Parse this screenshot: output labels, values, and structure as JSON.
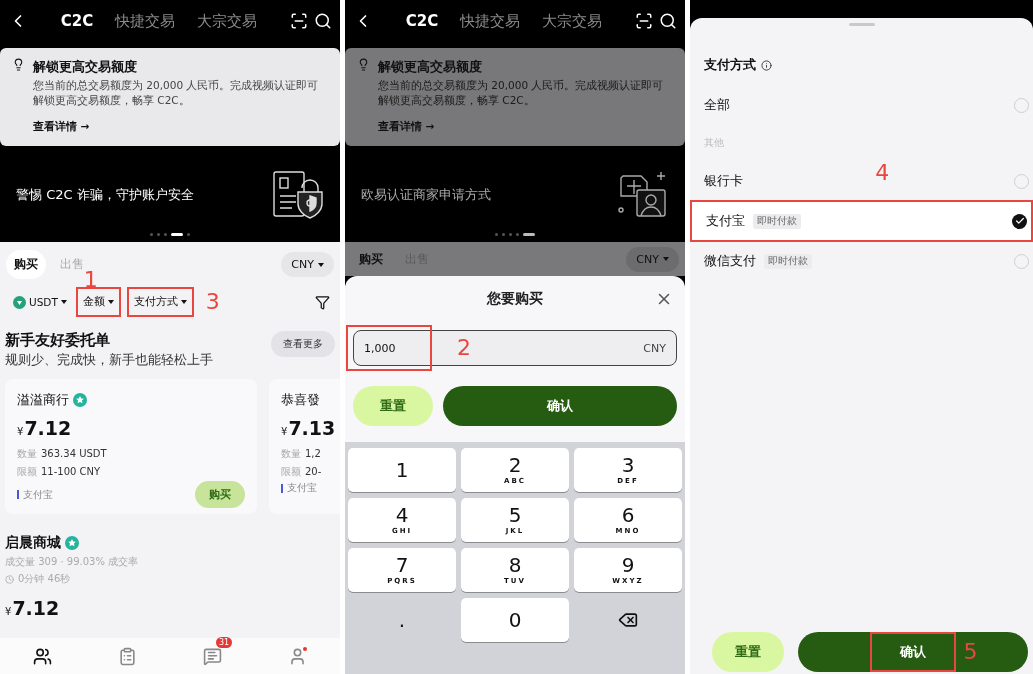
{
  "market_screen": {
    "header": {
      "tabs": [
        {
          "label": "C2C",
          "selected": true
        },
        {
          "label": "快捷交易",
          "selected": false
        },
        {
          "label": "大宗交易",
          "selected": false
        }
      ]
    },
    "notice": {
      "title": "解锁更高交易额度",
      "body": "您当前的总交易额度为 20,000 人民币。完成视频认证即可解锁更高交易额度，畅享 C2C。",
      "link": "查看详情 →"
    },
    "promo": {
      "kind": "security",
      "text": "警惕 C2C 诈骗，守护账户安全",
      "dots": [
        {
          "selected": false
        },
        {
          "selected": false
        },
        {
          "selected": false
        },
        {
          "selected": true
        },
        {
          "selected": false
        }
      ]
    },
    "side_tabs": [
      {
        "label": "购买",
        "selected": true
      },
      {
        "label": "出售",
        "selected": false
      }
    ],
    "currency": "CNY",
    "filters": [
      {
        "kind": "coin",
        "label": "USDT"
      },
      {
        "kind": "plain",
        "label": "金额",
        "callout": "1"
      },
      {
        "kind": "plain",
        "label": "支付方式",
        "callout": "3"
      }
    ],
    "section": {
      "title": "新手友好委托单",
      "subtitle": "规则少、完成快，新手也能轻松上手",
      "more": "查看更多"
    },
    "offers": [
      {
        "merchant": "溢溢商行",
        "verified": true,
        "symbol": "¥",
        "price": "7.12",
        "quantity_label": "数量",
        "quantity": "363.34 USDT",
        "limit_label": "限额",
        "limit": "11-100 CNY",
        "payment": "支付宝",
        "action": "购买"
      },
      {
        "merchant": "恭喜發",
        "verified": false,
        "symbol": "¥",
        "price": "7.13",
        "quantity_label": "数量",
        "quantity": "1,2",
        "limit_label": "限额",
        "limit": "20-",
        "payment": "支付宝"
      }
    ],
    "listing": {
      "merchant": "启晨商城",
      "verified": true,
      "stats": "成交量 309 · 99.03% 成交率",
      "time": "0分钟 46秒",
      "symbol": "¥",
      "price": "7.12"
    },
    "nav": [
      {
        "kind": "c2c",
        "selected": true
      },
      {
        "kind": "orders",
        "selected": false
      },
      {
        "kind": "messages",
        "selected": false,
        "badge": "31"
      },
      {
        "kind": "profile",
        "selected": false,
        "dot": true
      }
    ]
  },
  "amount_screen": {
    "header": {
      "tabs": [
        {
          "label": "C2C",
          "selected": true
        },
        {
          "label": "快捷交易",
          "selected": false
        },
        {
          "label": "大宗交易",
          "selected": false
        }
      ]
    },
    "notice": {
      "title": "解锁更高交易额度",
      "body": "您当前的总交易额度为 20,000 人民币。完成视频认证即可解锁更高交易额度，畅享 C2C。",
      "link": "查看详情 →"
    },
    "promo": {
      "kind": "merchant",
      "text": "欧易认证商家申请方式",
      "dots": [
        {
          "selected": false
        },
        {
          "selected": false
        },
        {
          "selected": false
        },
        {
          "selected": false
        },
        {
          "selected": true
        }
      ]
    },
    "side_tabs": [
      {
        "label": "购买",
        "selected": true
      },
      {
        "label": "出售",
        "selected": false
      }
    ],
    "currency": "CNY",
    "sheet": {
      "title": "您要购买",
      "amount": {
        "value": "1,000",
        "unit": "CNY",
        "callout": "2"
      },
      "reset": "重置",
      "confirm": "确认",
      "keys": [
        {
          "kind": "digit",
          "label": "1"
        },
        {
          "kind": "digit",
          "label": "2",
          "letters": "ABC"
        },
        {
          "kind": "digit",
          "label": "3",
          "letters": "DEF"
        },
        {
          "kind": "digit",
          "label": "4",
          "letters": "GHI"
        },
        {
          "kind": "digit",
          "label": "5",
          "letters": "JKL"
        },
        {
          "kind": "digit",
          "label": "6",
          "letters": "MNO"
        },
        {
          "kind": "digit",
          "label": "7",
          "letters": "PQRS"
        },
        {
          "kind": "digit",
          "label": "8",
          "letters": "TUV"
        },
        {
          "kind": "digit",
          "label": "9",
          "letters": "WXYZ"
        },
        {
          "kind": "symbol",
          "label": "."
        },
        {
          "kind": "digit",
          "label": "0"
        },
        {
          "kind": "backspace"
        }
      ]
    }
  },
  "payment_screen": {
    "sheet": {
      "title": "支付方式",
      "options": [
        {
          "kind": "option",
          "label": "全部",
          "selected": false
        },
        {
          "kind": "group",
          "label": "其他"
        },
        {
          "kind": "option",
          "label": "银行卡",
          "selected": false
        },
        {
          "kind": "option",
          "label": "支付宝",
          "tag": "即时付款",
          "selected": true,
          "callout": "4"
        },
        {
          "kind": "option",
          "label": "微信支付",
          "tag": "即时付款",
          "selected": false
        }
      ],
      "reset": "重置",
      "confirm": {
        "label": "确认",
        "callout": "5"
      }
    }
  }
}
